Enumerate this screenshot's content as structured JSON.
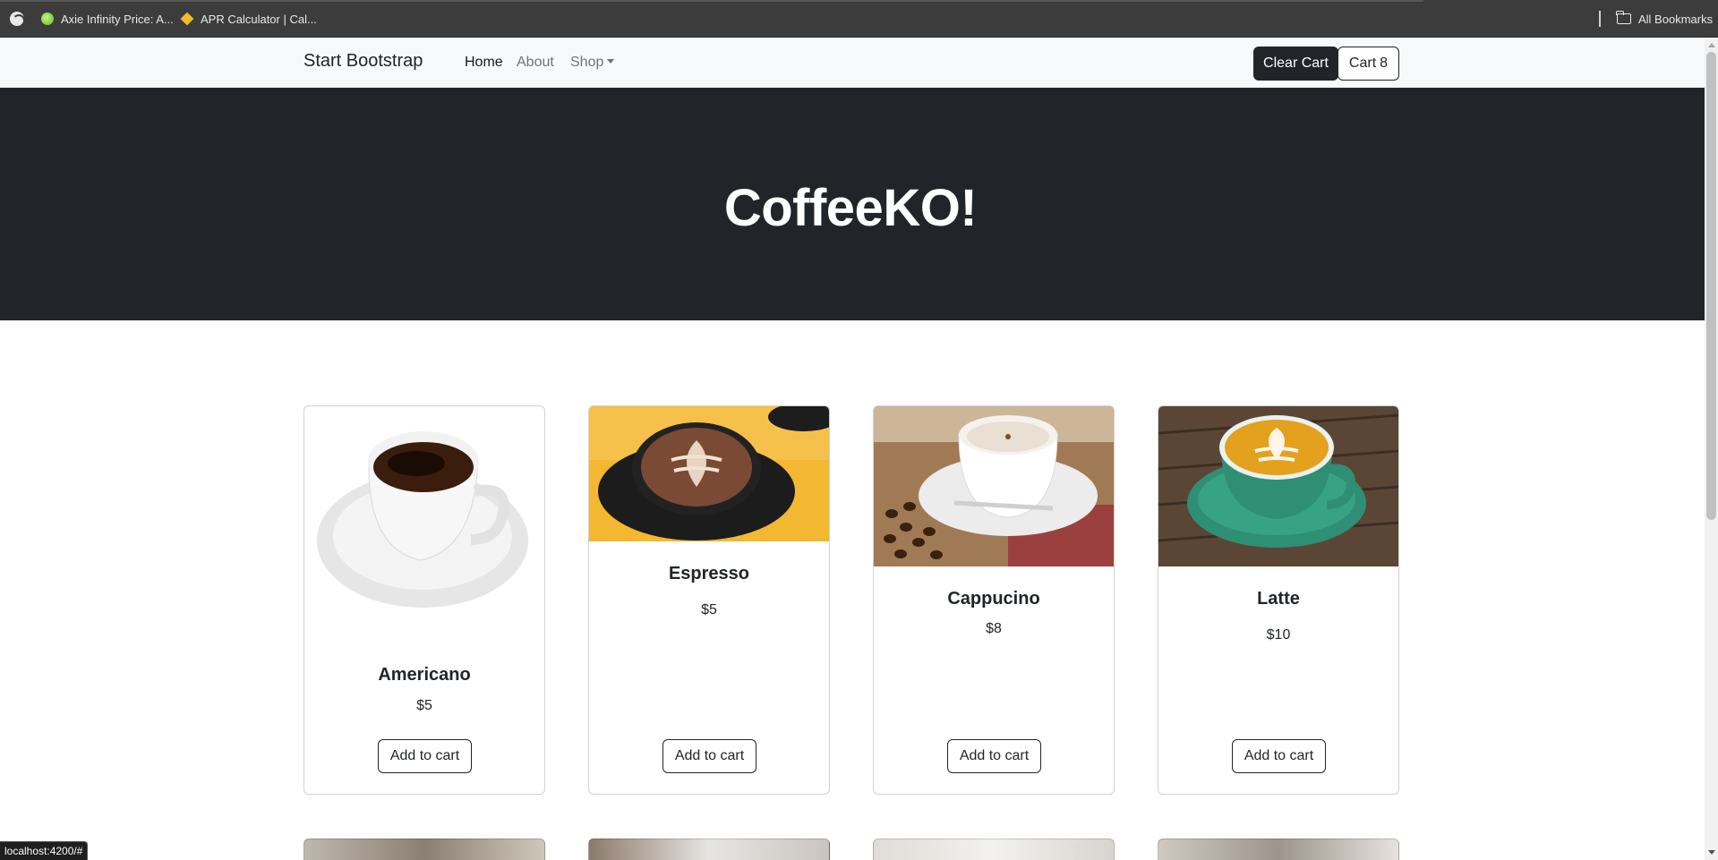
{
  "bookmarks": {
    "items": [
      {
        "label": "Axie Infinity Price: A...",
        "icon": "axie-icon"
      },
      {
        "label": "APR Calculator | Cal...",
        "icon": "binance-icon"
      }
    ],
    "all_bookmarks": "All Bookmarks"
  },
  "navbar": {
    "brand": "Start Bootstrap",
    "links": [
      "Home",
      "About",
      "Shop"
    ],
    "clear_cart": "Clear Cart",
    "cart_label": "Cart",
    "cart_count": "8"
  },
  "hero": {
    "title": "CoffeeKO!"
  },
  "products": [
    {
      "name": "Americano",
      "price": "$5",
      "button": "Add to cart"
    },
    {
      "name": "Espresso",
      "price": "$5",
      "button": "Add to cart"
    },
    {
      "name": "Cappucino",
      "price": "$8",
      "button": "Add to cart"
    },
    {
      "name": "Latte",
      "price": "$10",
      "button": "Add to cart"
    }
  ],
  "status_bar": {
    "url": "localhost:4200/#"
  },
  "colors": {
    "dark": "#212529",
    "navbar_bg": "#f8f9fa",
    "chrome_bar": "#3c3c3c"
  }
}
